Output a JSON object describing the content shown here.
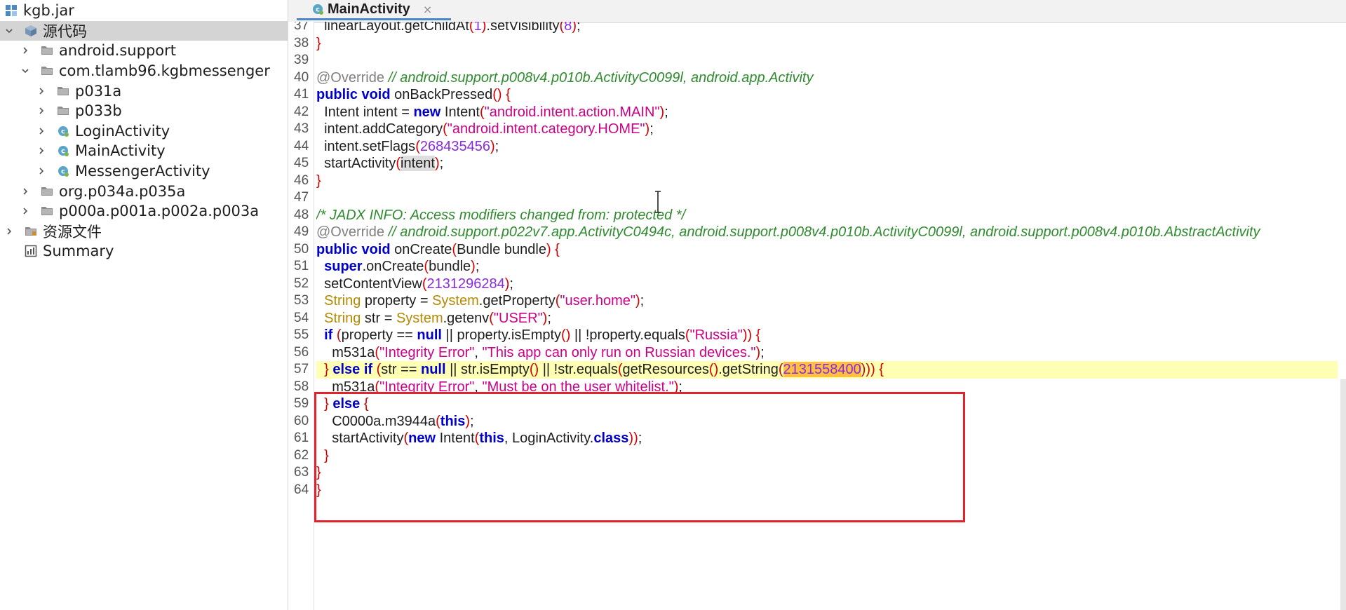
{
  "tree": {
    "items": [
      {
        "label": "kgb.jar",
        "depth": 0,
        "caret": "none",
        "icon": "jar-icon",
        "selected": false
      },
      {
        "label": "源代码",
        "depth": 0,
        "caret": "down",
        "icon": "source-package-icon",
        "selected": true
      },
      {
        "label": "android.support",
        "depth": 1,
        "caret": "right",
        "icon": "folder-icon",
        "selected": false
      },
      {
        "label": "com.tlamb96.kgbmessenger",
        "depth": 1,
        "caret": "down",
        "icon": "folder-icon",
        "selected": false
      },
      {
        "label": "p031a",
        "depth": 2,
        "caret": "right",
        "icon": "folder-icon",
        "selected": false
      },
      {
        "label": "p033b",
        "depth": 2,
        "caret": "right",
        "icon": "folder-icon",
        "selected": false
      },
      {
        "label": "LoginActivity",
        "depth": 2,
        "caret": "right",
        "icon": "class-icon",
        "selected": false
      },
      {
        "label": "MainActivity",
        "depth": 2,
        "caret": "right",
        "icon": "class-icon",
        "selected": false
      },
      {
        "label": "MessengerActivity",
        "depth": 2,
        "caret": "right",
        "icon": "class-icon",
        "selected": false
      },
      {
        "label": "org.p034a.p035a",
        "depth": 1,
        "caret": "right",
        "icon": "folder-icon",
        "selected": false
      },
      {
        "label": "p000a.p001a.p002a.p003a",
        "depth": 1,
        "caret": "right",
        "icon": "folder-icon",
        "selected": false
      },
      {
        "label": "资源文件",
        "depth": 0,
        "caret": "right",
        "icon": "resources-folder-icon",
        "selected": false
      },
      {
        "label": "Summary",
        "depth": 0,
        "caret": "none",
        "icon": "summary-icon",
        "selected": false
      }
    ]
  },
  "editor": {
    "tab": {
      "label": "MainActivity",
      "close": "×",
      "icon": "class-icon"
    },
    "highlight_line": "57",
    "lines": [
      {
        "n": "37",
        "t": [
          [
            "p",
            "  linearLayout.getChildAt"
          ],
          [
            "b",
            "("
          ],
          [
            "num",
            "1"
          ],
          [
            "b",
            ")"
          ],
          [
            "p",
            ".setVisibility"
          ],
          [
            "b",
            "("
          ],
          [
            "num",
            "8"
          ],
          [
            "b",
            ")"
          ],
          [
            "p",
            ";"
          ]
        ]
      },
      {
        "n": "38",
        "t": [
          [
            "b",
            "}"
          ]
        ]
      },
      {
        "n": "39",
        "t": []
      },
      {
        "n": "40",
        "t": [
          [
            "ann",
            "@Override "
          ],
          [
            "com",
            "// android.support.p008v4.p010b.ActivityC0099l, android.app.Activity"
          ]
        ]
      },
      {
        "n": "41",
        "t": [
          [
            "kw",
            "public void"
          ],
          [
            "p",
            " onBackPressed"
          ],
          [
            "b",
            "() {"
          ]
        ]
      },
      {
        "n": "42",
        "t": [
          [
            "p",
            "  Intent intent = "
          ],
          [
            "kw",
            "new"
          ],
          [
            "p",
            " Intent"
          ],
          [
            "b",
            "("
          ],
          [
            "str",
            "\"android.intent.action.MAIN\""
          ],
          [
            "b",
            ")"
          ],
          [
            "p",
            ";"
          ]
        ]
      },
      {
        "n": "43",
        "t": [
          [
            "p",
            "  intent.addCategory"
          ],
          [
            "b",
            "("
          ],
          [
            "str",
            "\"android.intent.category.HOME\""
          ],
          [
            "b",
            ")"
          ],
          [
            "p",
            ";"
          ]
        ]
      },
      {
        "n": "44",
        "t": [
          [
            "p",
            "  intent.setFlags"
          ],
          [
            "b",
            "("
          ],
          [
            "num",
            "268435456"
          ],
          [
            "b",
            ")"
          ],
          [
            "p",
            ";"
          ]
        ]
      },
      {
        "n": "45",
        "t": [
          [
            "p",
            "  startActivity"
          ],
          [
            "b",
            "("
          ],
          [
            "var",
            "intent"
          ],
          [
            "b",
            ")"
          ],
          [
            "p",
            ";"
          ]
        ]
      },
      {
        "n": "46",
        "t": [
          [
            "b",
            "}"
          ]
        ]
      },
      {
        "n": "47",
        "t": []
      },
      {
        "n": "48",
        "t": [
          [
            "com",
            "/* JADX INFO: Access modifiers changed from: protected */"
          ]
        ]
      },
      {
        "n": "49",
        "t": [
          [
            "ann",
            "@Override "
          ],
          [
            "com",
            "// android.support.p022v7.app.ActivityC0494c, android.support.p008v4.p010b.ActivityC0099l, android.support.p008v4.p010b.AbstractActivity"
          ]
        ]
      },
      {
        "n": "50",
        "t": [
          [
            "kw",
            "public void"
          ],
          [
            "p",
            " onCreate"
          ],
          [
            "b",
            "("
          ],
          [
            "p",
            "Bundle bundle"
          ],
          [
            "b",
            ") {"
          ]
        ]
      },
      {
        "n": "51",
        "t": [
          [
            "kw",
            "  super"
          ],
          [
            "p",
            ".onCreate"
          ],
          [
            "b",
            "("
          ],
          [
            "p",
            "bundle"
          ],
          [
            "b",
            ")"
          ],
          [
            "p",
            ";"
          ]
        ]
      },
      {
        "n": "52",
        "t": [
          [
            "p",
            "  setContentView"
          ],
          [
            "b",
            "("
          ],
          [
            "num",
            "2131296284"
          ],
          [
            "b",
            ")"
          ],
          [
            "p",
            ";"
          ]
        ]
      },
      {
        "n": "53",
        "t": [
          [
            "typ",
            "  String"
          ],
          [
            "p",
            " property = "
          ],
          [
            "typ",
            "System"
          ],
          [
            "p",
            ".getProperty"
          ],
          [
            "b",
            "("
          ],
          [
            "str",
            "\"user.home\""
          ],
          [
            "b",
            ")"
          ],
          [
            "p",
            ";"
          ]
        ]
      },
      {
        "n": "54",
        "t": [
          [
            "typ",
            "  String"
          ],
          [
            "p",
            " str = "
          ],
          [
            "typ",
            "System"
          ],
          [
            "p",
            ".getenv"
          ],
          [
            "b",
            "("
          ],
          [
            "str",
            "\"USER\""
          ],
          [
            "b",
            ")"
          ],
          [
            "p",
            ";"
          ]
        ]
      },
      {
        "n": "55",
        "t": [
          [
            "kw",
            "  if"
          ],
          [
            "p",
            " "
          ],
          [
            "b",
            "("
          ],
          [
            "p",
            "property == "
          ],
          [
            "kw",
            "null"
          ],
          [
            "p",
            " || property.isEmpty"
          ],
          [
            "b",
            "()"
          ],
          [
            "p",
            " || !property.equals"
          ],
          [
            "b",
            "("
          ],
          [
            "str",
            "\"Russia\""
          ],
          [
            "b",
            ")) {"
          ]
        ]
      },
      {
        "n": "56",
        "t": [
          [
            "p",
            "    m531a"
          ],
          [
            "b",
            "("
          ],
          [
            "str",
            "\"Integrity Error\""
          ],
          [
            "p",
            ", "
          ],
          [
            "str",
            "\"This app can only run on Russian devices.\""
          ],
          [
            "b",
            ")"
          ],
          [
            "p",
            ";"
          ]
        ]
      },
      {
        "n": "57",
        "t": [
          [
            "b",
            "  } "
          ],
          [
            "kw",
            "else if"
          ],
          [
            "p",
            " "
          ],
          [
            "b",
            "("
          ],
          [
            "p",
            "str == "
          ],
          [
            "kw",
            "null"
          ],
          [
            "p",
            " || str.isEmpty"
          ],
          [
            "b",
            "()"
          ],
          [
            "p",
            " || !str.equals"
          ],
          [
            "b",
            "("
          ],
          [
            "p",
            "getResources"
          ],
          [
            "b",
            "()"
          ],
          [
            "p",
            ".getString"
          ],
          [
            "b",
            "("
          ],
          [
            "numhl",
            "2131558400"
          ],
          [
            "b",
            ")))"
          ],
          [
            "b",
            " {"
          ]
        ]
      },
      {
        "n": "58",
        "t": [
          [
            "p",
            "    m531a"
          ],
          [
            "b",
            "("
          ],
          [
            "str",
            "\"Integrity Error\""
          ],
          [
            "p",
            ", "
          ],
          [
            "str",
            "\"Must be on the user whitelist.\""
          ],
          [
            "b",
            ")"
          ],
          [
            "p",
            ";"
          ]
        ]
      },
      {
        "n": "59",
        "t": [
          [
            "b",
            "  } "
          ],
          [
            "kw",
            "else"
          ],
          [
            "b",
            " {"
          ]
        ]
      },
      {
        "n": "60",
        "t": [
          [
            "p",
            "    C0000a.m3944a"
          ],
          [
            "b",
            "("
          ],
          [
            "kw",
            "this"
          ],
          [
            "b",
            ")"
          ],
          [
            "p",
            ";"
          ]
        ]
      },
      {
        "n": "61",
        "t": [
          [
            "p",
            "    startActivity"
          ],
          [
            "b",
            "("
          ],
          [
            "kw",
            "new"
          ],
          [
            "p",
            " Intent"
          ],
          [
            "b",
            "("
          ],
          [
            "kw",
            "this"
          ],
          [
            "p",
            ", LoginActivity."
          ],
          [
            "kw",
            "class"
          ],
          [
            "b",
            "))"
          ],
          [
            "p",
            ";"
          ]
        ]
      },
      {
        "n": "62",
        "t": [
          [
            "b",
            "  }"
          ]
        ]
      },
      {
        "n": "63",
        "t": [
          [
            "b",
            "}"
          ]
        ]
      },
      {
        "n": "64",
        "t": [
          [
            "b",
            "}"
          ]
        ]
      }
    ]
  },
  "colors": {
    "annotation_box": "#e0232d",
    "line_highlight": "#ffffb3",
    "number_highlight": "#ffbf40",
    "keyword": "#0000cc",
    "string": "#cc0088",
    "number": "#8a2be2",
    "comment": "#2e8b2e"
  }
}
